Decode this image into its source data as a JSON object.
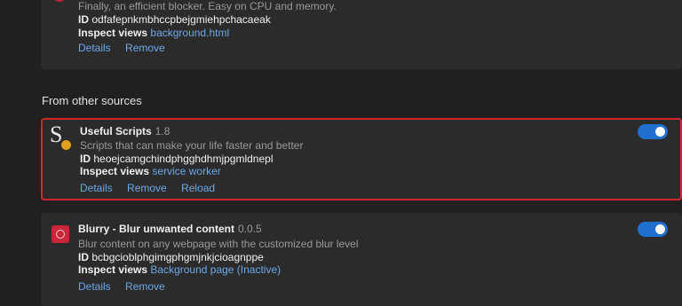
{
  "colors": {
    "background": "#202020",
    "card": "#2b2b2b",
    "link": "#6ea8e8",
    "toggle_on": "#1f6fcf",
    "highlight_border": "#d0262e"
  },
  "top_extension": {
    "description": "Finally, an efficient blocker. Easy on CPU and memory.",
    "id_label": "ID",
    "id_value": "odfafepnkmbhccpbejgmiehpchacaeak",
    "inspect_label": "Inspect views",
    "inspect_link": "background.html",
    "details": "Details",
    "remove": "Remove"
  },
  "section_title": "From other sources",
  "useful_scripts": {
    "icon": "useful-scripts-logo-icon",
    "name": "Useful Scripts",
    "version": "1.8",
    "description": "Scripts that can make your life faster and better",
    "id_label": "ID",
    "id_value": "heoejcamgchindphgghdhmjpgmldnepl",
    "inspect_label": "Inspect views",
    "inspect_link": "service worker",
    "details": "Details",
    "remove": "Remove",
    "reload": "Reload",
    "enabled": true
  },
  "blurry": {
    "icon": "blurry-logo-icon",
    "name": "Blurry - Blur unwanted content",
    "version": "0.0.5",
    "description": "Blur content on any webpage with the customized blur level",
    "id_label": "ID",
    "id_value": "bcbgcioblphgimgphgmjnkjcioagnppe",
    "inspect_label": "Inspect views",
    "inspect_link": "Background page (Inactive)",
    "details": "Details",
    "remove": "Remove",
    "enabled": true
  }
}
